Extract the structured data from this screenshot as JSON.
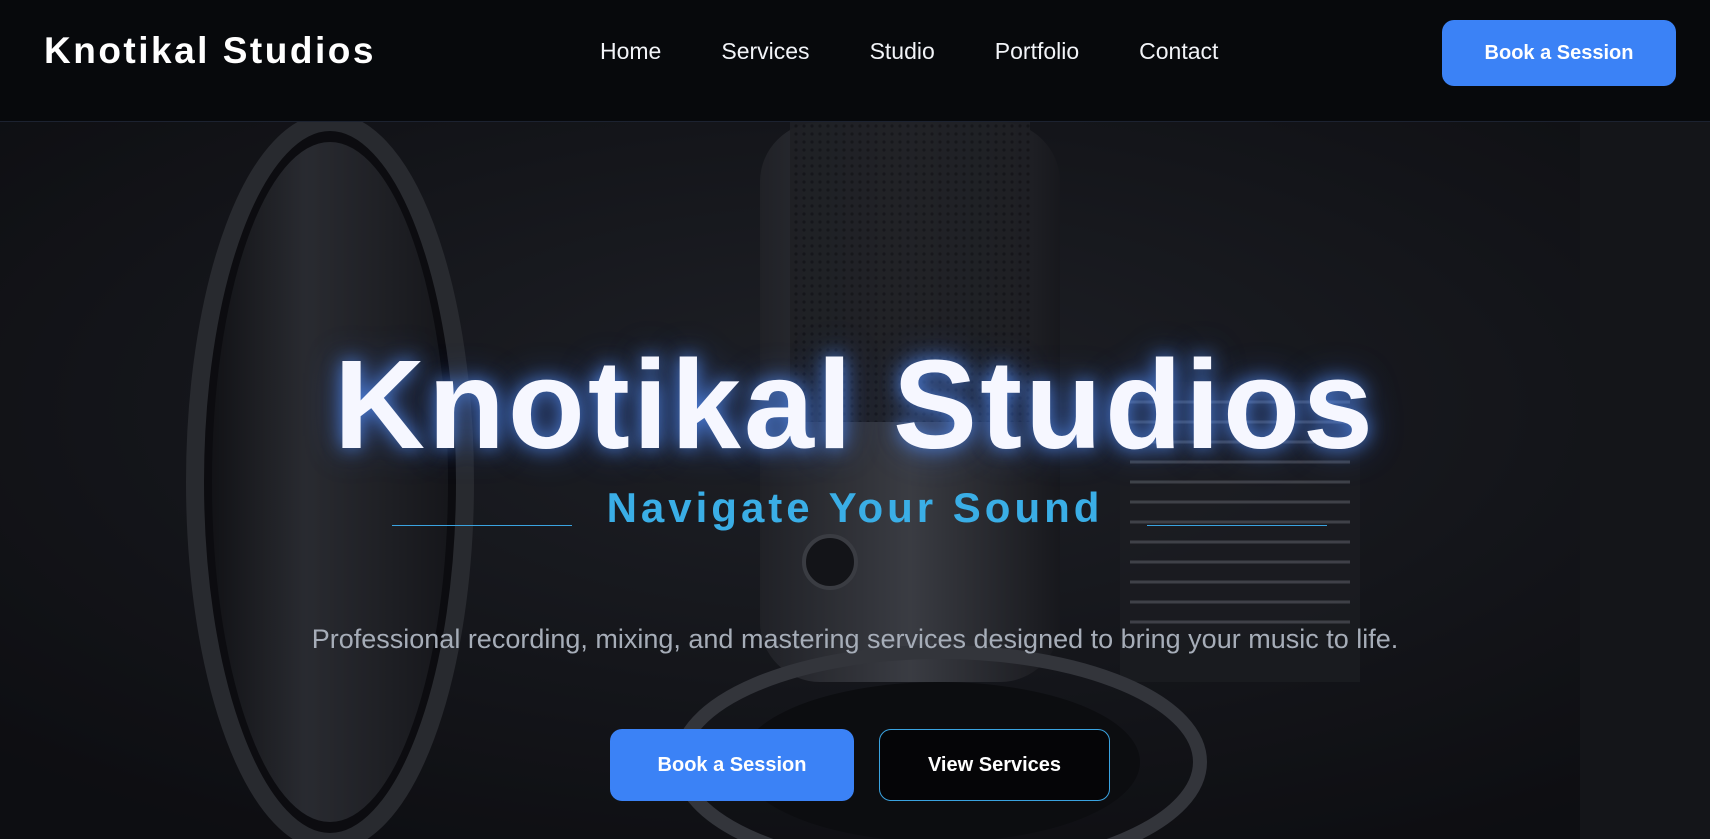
{
  "nav": {
    "brand": "Knotikal Studios",
    "links": [
      "Home",
      "Services",
      "Studio",
      "Portfolio",
      "Contact"
    ],
    "cta_label": "Book a Session"
  },
  "hero": {
    "title": "Knotikal Studios",
    "tagline": "Navigate Your Sound",
    "description": "Professional recording, mixing, and mastering services designed to bring your music to life.",
    "primary_button": "Book a Session",
    "secondary_button": "View Services"
  },
  "colors": {
    "accent": "#3b82f6",
    "tagline": "#3aaee6",
    "navbar_bg": "#07090c",
    "description_text": "#a6adb8"
  }
}
